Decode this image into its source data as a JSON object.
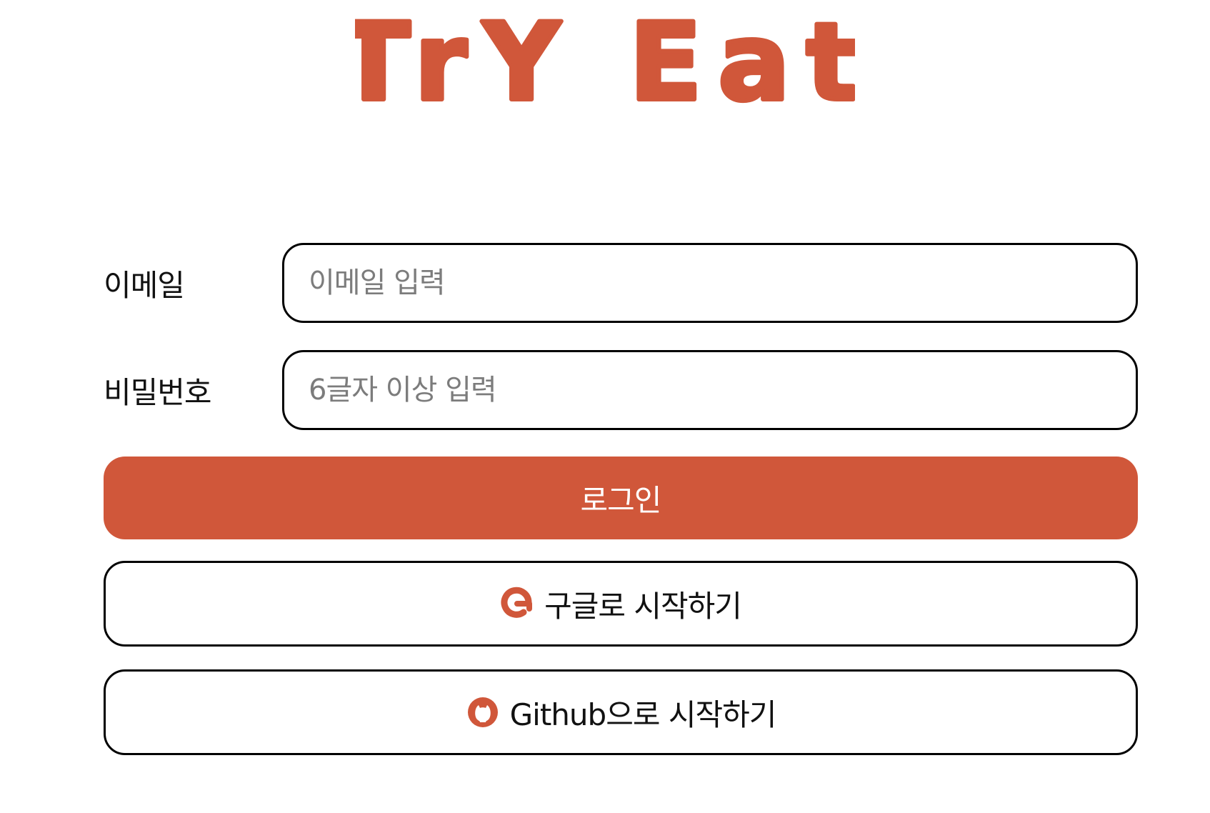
{
  "brand": {
    "logo_text": "TrY Eat",
    "color": "#d0573a"
  },
  "form": {
    "email": {
      "label": "이메일",
      "placeholder": "이메일 입력",
      "value": ""
    },
    "password": {
      "label": "비밀번호",
      "placeholder": "6글자 이상 입력",
      "value": ""
    }
  },
  "buttons": {
    "login": {
      "label": "로그인"
    },
    "google": {
      "label": "구글로 시작하기",
      "icon": "google-icon"
    },
    "github": {
      "label": "Github으로 시작하기",
      "icon": "github-icon"
    }
  },
  "colors": {
    "accent": "#d0573a",
    "border": "#000000",
    "placeholder": "#7c7c7c"
  }
}
